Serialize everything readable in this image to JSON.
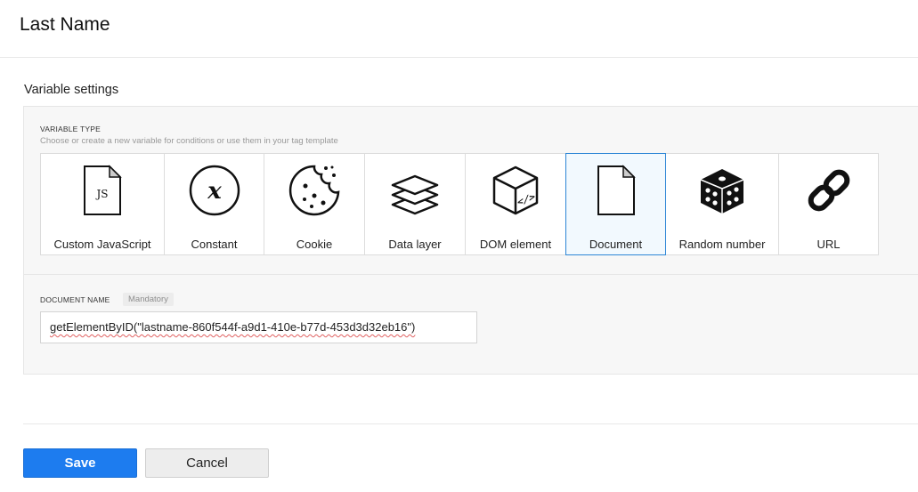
{
  "header": {
    "title": "Last Name"
  },
  "settings": {
    "section_title": "Variable settings",
    "variable_type": {
      "label": "VARIABLE TYPE",
      "help": "Choose or create a new variable for conditions or use them in your tag template",
      "selected": "Document",
      "options": [
        {
          "label": "Custom JavaScript",
          "icon": "js-file-icon"
        },
        {
          "label": "Constant",
          "icon": "constant-x-icon"
        },
        {
          "label": "Cookie",
          "icon": "cookie-icon"
        },
        {
          "label": "Data layer",
          "icon": "layers-icon"
        },
        {
          "label": "DOM element",
          "icon": "dom-cube-icon"
        },
        {
          "label": "Document",
          "icon": "document-icon"
        },
        {
          "label": "Random number",
          "icon": "dice-icon"
        },
        {
          "label": "URL",
          "icon": "link-icon"
        }
      ]
    },
    "document_name": {
      "label": "DOCUMENT NAME",
      "badge": "Mandatory",
      "value": "getElementByID(\"lastname-860f544f-a9d1-410e-b77d-453d3d32eb16\")"
    }
  },
  "actions": {
    "save_label": "Save",
    "cancel_label": "Cancel"
  },
  "colors": {
    "primary": "#1d7cef",
    "selected_border": "#2d86d6"
  }
}
